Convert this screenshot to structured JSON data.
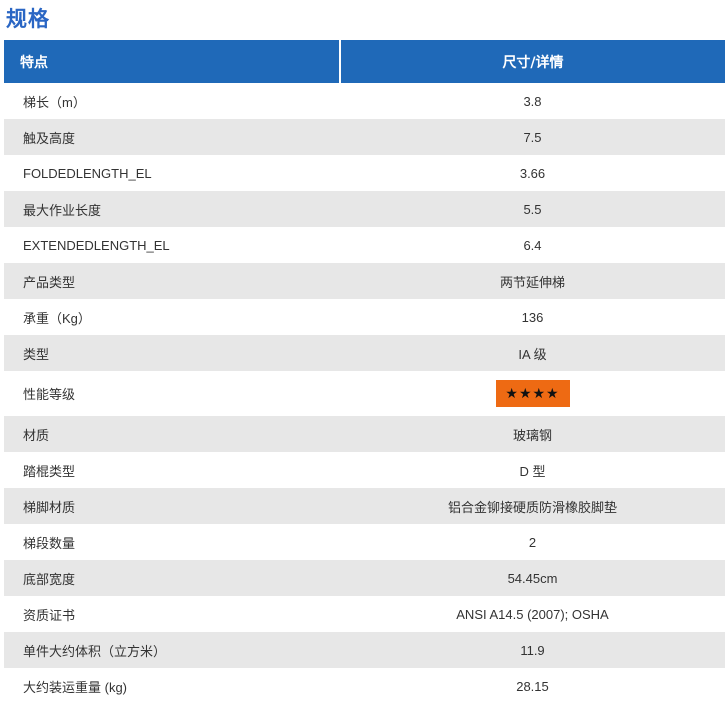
{
  "page": {
    "title": "规格"
  },
  "table": {
    "headers": [
      "特点",
      "尺寸/详情"
    ],
    "rows": [
      {
        "label": "梯长（m）",
        "value": "3.8"
      },
      {
        "label": "触及高度",
        "value": "7.5"
      },
      {
        "label": "FOLDEDLENGTH_EL",
        "value": "3.66"
      },
      {
        "label": "最大作业长度",
        "value": "5.5"
      },
      {
        "label": "EXTENDEDLENGTH_EL",
        "value": "6.4"
      },
      {
        "label": "产品类型",
        "value": "两节延伸梯"
      },
      {
        "label": "承重（Kg）",
        "value": "136"
      },
      {
        "label": "类型",
        "value": "IA 级"
      },
      {
        "label": "性能等级",
        "value": "★★★★",
        "rating": 4,
        "rating_max": 4,
        "badge_color": "#ee6a13"
      },
      {
        "label": "材质",
        "value": "玻璃钢"
      },
      {
        "label": "踏棍类型",
        "value": "D 型"
      },
      {
        "label": "梯脚材质",
        "value": "铝合金铆接硬质防滑橡胶脚垫"
      },
      {
        "label": "梯段数量",
        "value": "2"
      },
      {
        "label": "底部宽度",
        "value": "54.45cm"
      },
      {
        "label": "资质证书",
        "value": "ANSI A14.5 (2007); OSHA"
      },
      {
        "label": "单件大约体积（立方米）",
        "value": "11.9"
      },
      {
        "label": "大约装运重量 (kg)",
        "value": "28.15"
      }
    ]
  },
  "colors": {
    "header_bg": "#1f69b8",
    "title": "#2a66c4",
    "stripe": "#e7e7e7"
  }
}
